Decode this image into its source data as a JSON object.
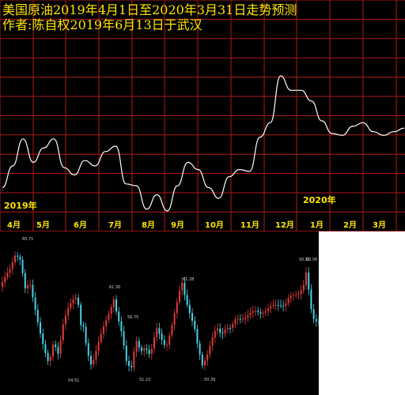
{
  "titles": {
    "line1": "美国原油2019年4月1日至2020年3月31日走势预测",
    "line2": "作者:陈自权2019年6月13日于武汉"
  },
  "colors": {
    "background": "#000000",
    "grid": "#b01818",
    "text": "#ffe600",
    "line": "#ffffff",
    "candle_up": "#e23a3a",
    "candle_down": "#46d2e6"
  },
  "chart_data": [
    {
      "type": "line",
      "year_labels": {
        "start": "2019年",
        "mid": "2020年"
      },
      "categories": [
        "4月",
        "5月",
        "6月",
        "7月",
        "8月",
        "9月",
        "10月",
        "11月",
        "12月",
        "1月",
        "2月",
        "3月"
      ],
      "series": [
        {
          "values": [
            2.0,
            3.2,
            4.7,
            3.4,
            4.2,
            4.7,
            3.1,
            2.7,
            3.5,
            3.2,
            4.0,
            4.3,
            2.2,
            2.1,
            0.8,
            1.6,
            0.7,
            2.1,
            3.4,
            3.0,
            2.0,
            1.4,
            2.6,
            3.0,
            2.9,
            4.8,
            5.6,
            8.2,
            7.4,
            7.4,
            6.8,
            5.7,
            5.0,
            4.9,
            5.4,
            5.6,
            5.1,
            4.9,
            5.1,
            5.3
          ]
        }
      ],
      "grid": true
    },
    {
      "type": "candlestick",
      "price_labels": [
        "65.71",
        "61.30",
        "61.28",
        "60.56",
        "54.51",
        "56.75",
        "51.22",
        "50.39",
        "50.51"
      ],
      "grid": false
    }
  ]
}
